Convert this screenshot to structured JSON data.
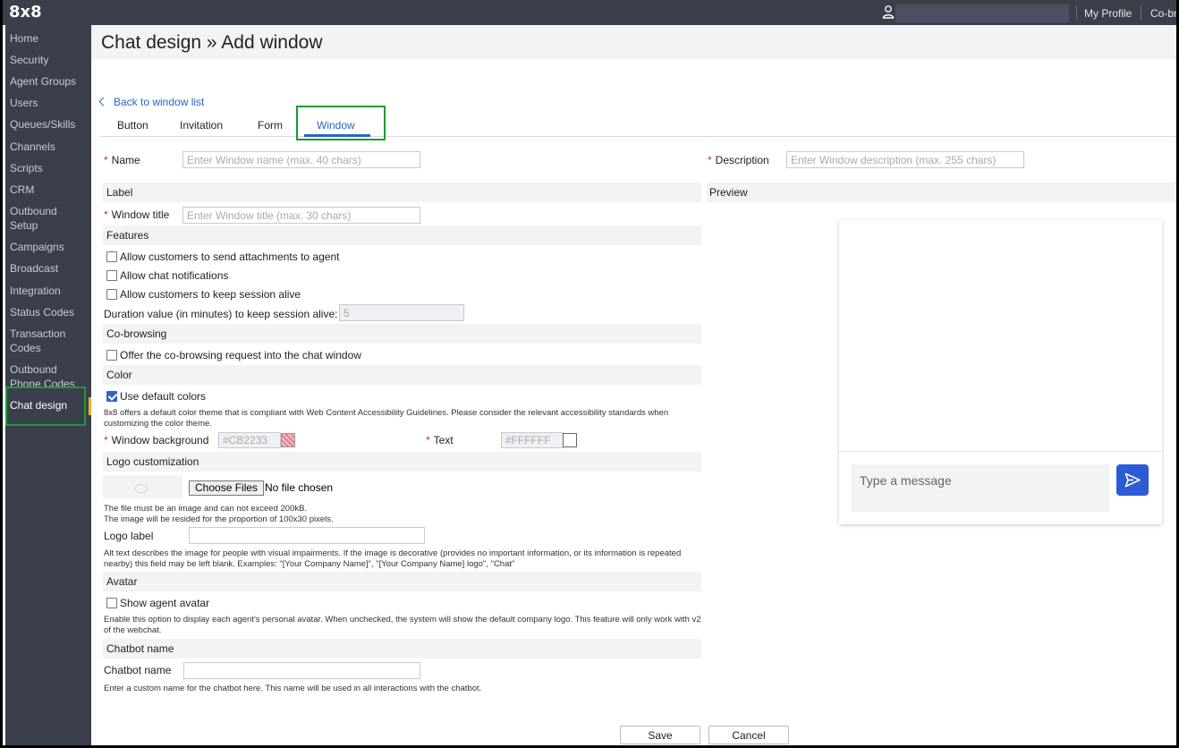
{
  "topbar": {
    "logo": "8x8",
    "my_profile": "My Profile",
    "cobrowse": "Co-br"
  },
  "sidebar": {
    "items": [
      {
        "label": "Home"
      },
      {
        "label": "Security"
      },
      {
        "label": "Agent Groups"
      },
      {
        "label": "Users"
      },
      {
        "label": "Queues/Skills"
      },
      {
        "label": "Channels"
      },
      {
        "label": "Scripts"
      },
      {
        "label": "CRM"
      },
      {
        "label": "Outbound Setup"
      },
      {
        "label": "Campaigns"
      },
      {
        "label": "Broadcast"
      },
      {
        "label": "Integration"
      },
      {
        "label": "Status Codes"
      },
      {
        "label": "Transaction Codes"
      },
      {
        "label": "Outbound Phone Codes"
      },
      {
        "label": "Chat design"
      }
    ]
  },
  "header": {
    "title": "Chat design » Add window"
  },
  "back_link": "Back to window list",
  "tabs": [
    "Button",
    "Invitation",
    "Form",
    "Window"
  ],
  "form": {
    "name_label": "Name",
    "name_placeholder": "Enter Window name (max. 40 chars)",
    "description_label": "Description",
    "description_placeholder": "Enter Window description (max. 255 chars)",
    "label_section": "Label",
    "window_title_label": "Window title",
    "window_title_placeholder": "Enter Window title (max. 30 chars)",
    "features_section": "Features",
    "feature_attachments": "Allow customers to send attachments to agent",
    "feature_notifications": "Allow chat notifications",
    "feature_keep_alive": "Allow customers to keep session alive",
    "duration_label": "Duration value (in minutes) to keep session alive:",
    "duration_value": "5",
    "cobrowsing_section": "Co-browsing",
    "cobrowsing_offer": "Offer the co-browsing request into the chat window",
    "color_section": "Color",
    "use_default_colors": "Use default colors",
    "color_note": "8x8 offers a default color theme that is compliant with Web Content Accessibility Guidelines. Please consider the relevant accessibility standards when customizing the color theme.",
    "window_background_label": "Window background",
    "window_background_value": "#CB2233",
    "text_label": "Text",
    "text_value": "#FFFFFF",
    "logo_section": "Logo customization",
    "choose_files": "Choose Files",
    "no_file": "No file chosen",
    "file_note_1": "The file must be an image and can not exceed 200kB.",
    "file_note_2": "The image will be resided for the proportion of 100x30 pixels.",
    "logo_label": "Logo label",
    "alt_note": "Alt text describes the image for people with visual impairments. If the image is decorative (provides no important information, or its information is repeated nearby) this field may be left blank. Examples: \"[Your Company Name]\", \"[Your Company Name] logo\", \"Chat\"",
    "avatar_section": "Avatar",
    "show_agent_avatar": "Show agent avatar",
    "avatar_note": "Enable this option to display each agent's personal avatar. When unchecked, the system will show the default company logo. This feature will only work with v2 of the webchat.",
    "chatbot_section": "Chatbot name",
    "chatbot_label": "Chatbot name",
    "chatbot_note": "Enter a custom name for the chatbot here. This name will be used in all interactions with the chatbot."
  },
  "preview": {
    "title": "Preview",
    "message_placeholder": "Type a message"
  },
  "actions": {
    "save": "Save",
    "cancel": "Cancel"
  },
  "colors": {
    "sidebar": "#3a3f4b",
    "accent": "#2a64c8",
    "highlight": "#1f9a32",
    "send": "#2d5bd6"
  }
}
